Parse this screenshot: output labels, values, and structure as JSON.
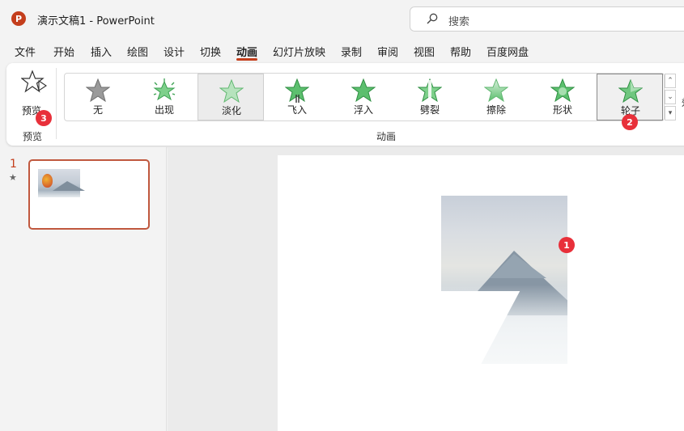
{
  "titlebar": {
    "app_icon_letter": "P",
    "title": "演示文稿1  -  PowerPoint",
    "search_placeholder": "搜索"
  },
  "menu": {
    "tabs": [
      "文件",
      "开始",
      "插入",
      "绘图",
      "设计",
      "切换",
      "动画",
      "幻灯片放映",
      "录制",
      "审阅",
      "视图",
      "帮助",
      "百度网盘"
    ],
    "active": "动画"
  },
  "ribbon": {
    "preview": {
      "label": "预览",
      "group_label": "预览"
    },
    "animations": {
      "group_label": "动画",
      "items": [
        {
          "label": "无",
          "state": "none"
        },
        {
          "label": "出现",
          "state": "normal"
        },
        {
          "label": "淡化",
          "state": "selected"
        },
        {
          "label": "飞入",
          "state": "normal"
        },
        {
          "label": "浮入",
          "state": "normal"
        },
        {
          "label": "劈裂",
          "state": "normal"
        },
        {
          "label": "擦除",
          "state": "normal"
        },
        {
          "label": "形状",
          "state": "normal"
        },
        {
          "label": "轮子",
          "state": "hover"
        }
      ]
    },
    "cut_label": "效"
  },
  "badges": {
    "picture": "1",
    "wheel": "2",
    "preview": "3"
  },
  "slides": {
    "current_number": "1",
    "animation_marker": "★"
  },
  "colors": {
    "accent": "#c43e1c",
    "badge": "#e8303a",
    "star_green": "#5cbf6e",
    "star_gray": "#9a9a9a"
  }
}
